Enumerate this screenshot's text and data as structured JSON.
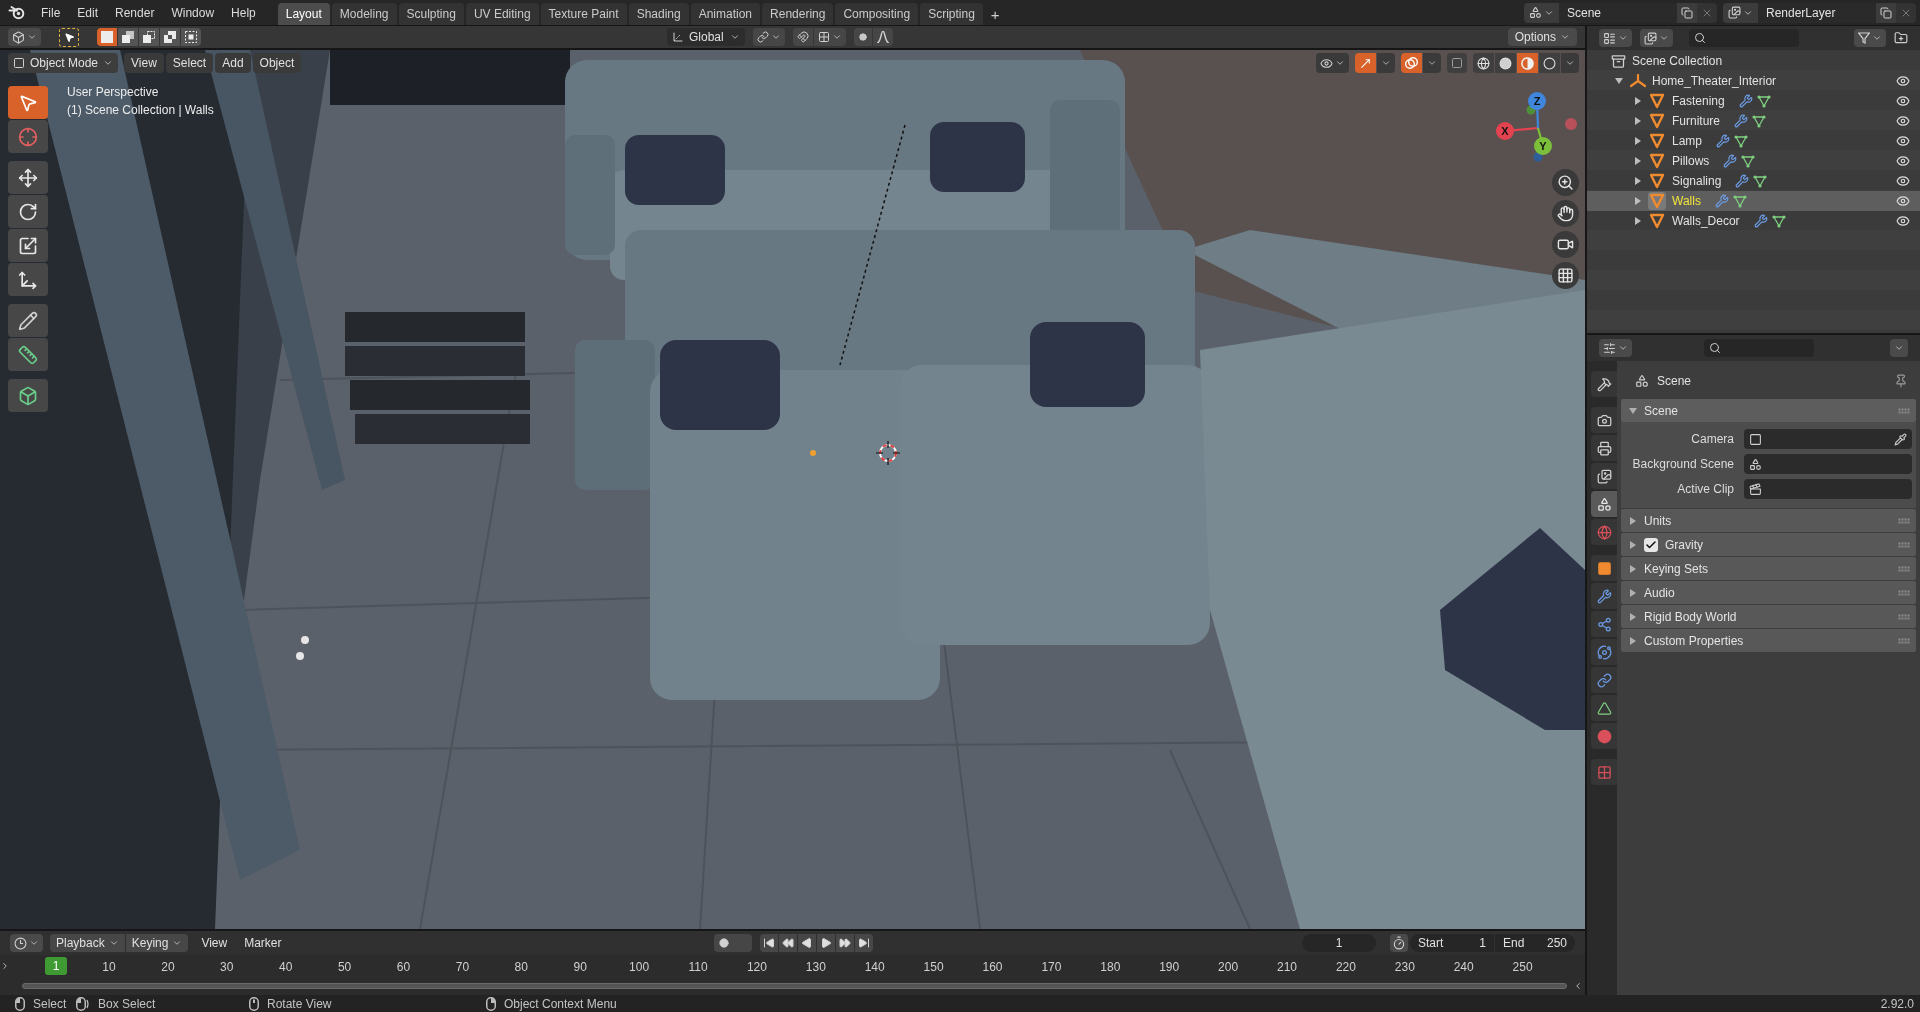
{
  "top_bar": {
    "menus": [
      "File",
      "Edit",
      "Render",
      "Window",
      "Help"
    ],
    "workspaces": [
      {
        "label": "Layout",
        "selected": true
      },
      {
        "label": "Modeling",
        "selected": false
      },
      {
        "label": "Sculpting",
        "selected": false
      },
      {
        "label": "UV Editing",
        "selected": false
      },
      {
        "label": "Texture Paint",
        "selected": false
      },
      {
        "label": "Shading",
        "selected": false
      },
      {
        "label": "Animation",
        "selected": false
      },
      {
        "label": "Rendering",
        "selected": false
      },
      {
        "label": "Compositing",
        "selected": false
      },
      {
        "label": "Scripting",
        "selected": false
      }
    ],
    "add_workspace": "+",
    "scene": "Scene",
    "view_layer": "RenderLayer"
  },
  "tool_settings": {
    "select_modes": [
      {
        "kind": "set",
        "selected": true
      },
      {
        "kind": "extend",
        "selected": false
      },
      {
        "kind": "subtract",
        "selected": false
      },
      {
        "kind": "invert",
        "selected": false
      },
      {
        "kind": "intersect",
        "selected": false
      }
    ],
    "orientation": "Global",
    "snap": false,
    "proportional": false,
    "options": "Options"
  },
  "viewport": {
    "mode": "Object Mode",
    "menus": [
      "View",
      "Select",
      "Add",
      "Object"
    ],
    "gizmos": true,
    "overlays": true,
    "xray": false,
    "shading": [
      {
        "kind": "wireframe",
        "selected": false
      },
      {
        "kind": "solid",
        "selected": false
      },
      {
        "kind": "material",
        "selected": true
      },
      {
        "kind": "rendered",
        "selected": false
      }
    ],
    "info": [
      "User Perspective",
      "(1) Scene Collection | Walls"
    ],
    "tool_groups": [
      [
        {
          "kind": "select",
          "selected": true
        },
        {
          "kind": "cursor",
          "selected": false
        }
      ],
      [
        {
          "kind": "move",
          "selected": false
        },
        {
          "kind": "rotate",
          "selected": false
        },
        {
          "kind": "scale",
          "selected": false
        },
        {
          "kind": "transform",
          "selected": false
        }
      ],
      [
        {
          "kind": "annotate",
          "selected": false
        },
        {
          "kind": "measure",
          "selected": false
        }
      ],
      [
        {
          "kind": "add_cube",
          "selected": false
        }
      ]
    ],
    "axes": [
      {
        "label": "X",
        "color": "#e2434f"
      },
      {
        "label": "Y",
        "color": "#7cbf3a"
      },
      {
        "label": "Z",
        "color": "#3f86dc"
      }
    ]
  },
  "outliner": {
    "root": "Scene Collection",
    "items": [
      {
        "kind": "empty",
        "name": "Home_Theater_Interior",
        "expanded": true,
        "visible": true,
        "selected": false,
        "children": [
          {
            "kind": "mesh",
            "name": "Fastening",
            "expanded": false,
            "visible": true,
            "selected": false
          },
          {
            "kind": "mesh",
            "name": "Furniture",
            "expanded": false,
            "visible": true,
            "selected": false
          },
          {
            "kind": "mesh",
            "name": "Lamp",
            "expanded": false,
            "visible": true,
            "selected": false
          },
          {
            "kind": "mesh",
            "name": "Pillows",
            "expanded": false,
            "visible": true,
            "selected": false
          },
          {
            "kind": "mesh",
            "name": "Signaling",
            "expanded": false,
            "visible": true,
            "selected": false
          },
          {
            "kind": "mesh",
            "name": "Walls",
            "expanded": false,
            "visible": true,
            "selected": true
          },
          {
            "kind": "mesh",
            "name": "Walls_Decor",
            "expanded": false,
            "visible": true,
            "selected": false
          }
        ]
      }
    ]
  },
  "properties": {
    "tab_groups": [
      [
        {
          "kind": "tool",
          "selected": false
        }
      ],
      [
        {
          "kind": "render",
          "selected": false
        },
        {
          "kind": "output",
          "selected": false
        },
        {
          "kind": "view_layer",
          "selected": false
        },
        {
          "kind": "scene",
          "selected": true
        },
        {
          "kind": "world",
          "selected": false
        }
      ],
      [
        {
          "kind": "object",
          "selected": false
        },
        {
          "kind": "modifiers",
          "selected": false
        },
        {
          "kind": "particles",
          "selected": false
        },
        {
          "kind": "physics",
          "selected": false
        },
        {
          "kind": "constraints",
          "selected": false
        },
        {
          "kind": "data",
          "selected": false
        },
        {
          "kind": "material",
          "selected": false
        }
      ],
      [
        {
          "kind": "texture",
          "selected": false
        }
      ]
    ],
    "context": "Scene",
    "panels": [
      {
        "kind": "plain",
        "title": "Scene",
        "expanded": true,
        "fields": [
          {
            "kind": "camera",
            "label": "Camera"
          },
          {
            "kind": "scene",
            "label": "Background Scene"
          },
          {
            "kind": "clip",
            "label": "Active Clip"
          }
        ]
      },
      {
        "kind": "plain",
        "title": "Units",
        "expanded": false
      },
      {
        "kind": "checkbox",
        "title": "Gravity",
        "expanded": false,
        "checked": true
      },
      {
        "kind": "plain",
        "title": "Keying Sets",
        "expanded": false
      },
      {
        "kind": "plain",
        "title": "Audio",
        "expanded": false
      },
      {
        "kind": "plain",
        "title": "Rigid Body World",
        "expanded": false
      },
      {
        "kind": "plain",
        "title": "Custom Properties",
        "expanded": false
      }
    ]
  },
  "timeline": {
    "menus": [
      {
        "kind": "dropdown",
        "label": "Playback"
      },
      {
        "kind": "dropdown",
        "label": "Keying"
      },
      {
        "kind": "menu",
        "label": "View"
      },
      {
        "kind": "menu",
        "label": "Marker"
      }
    ],
    "current_frame": "1",
    "start_label": "Start",
    "start": "1",
    "end_label": "End",
    "end": "250",
    "playhead": "1",
    "ticks": [
      "10",
      "20",
      "30",
      "40",
      "50",
      "60",
      "70",
      "80",
      "90",
      "100",
      "110",
      "120",
      "130",
      "140",
      "150",
      "160",
      "170",
      "180",
      "190",
      "200",
      "210",
      "220",
      "230",
      "240",
      "250"
    ]
  },
  "status_bar": {
    "hints": [
      {
        "kind": "left",
        "label": "Select"
      },
      {
        "kind": "drag",
        "label": "Box Select"
      },
      {
        "kind": "middle",
        "label": "Rotate View"
      },
      {
        "kind": "right",
        "label": "Object Context Menu"
      }
    ],
    "version": "2.92.0"
  }
}
